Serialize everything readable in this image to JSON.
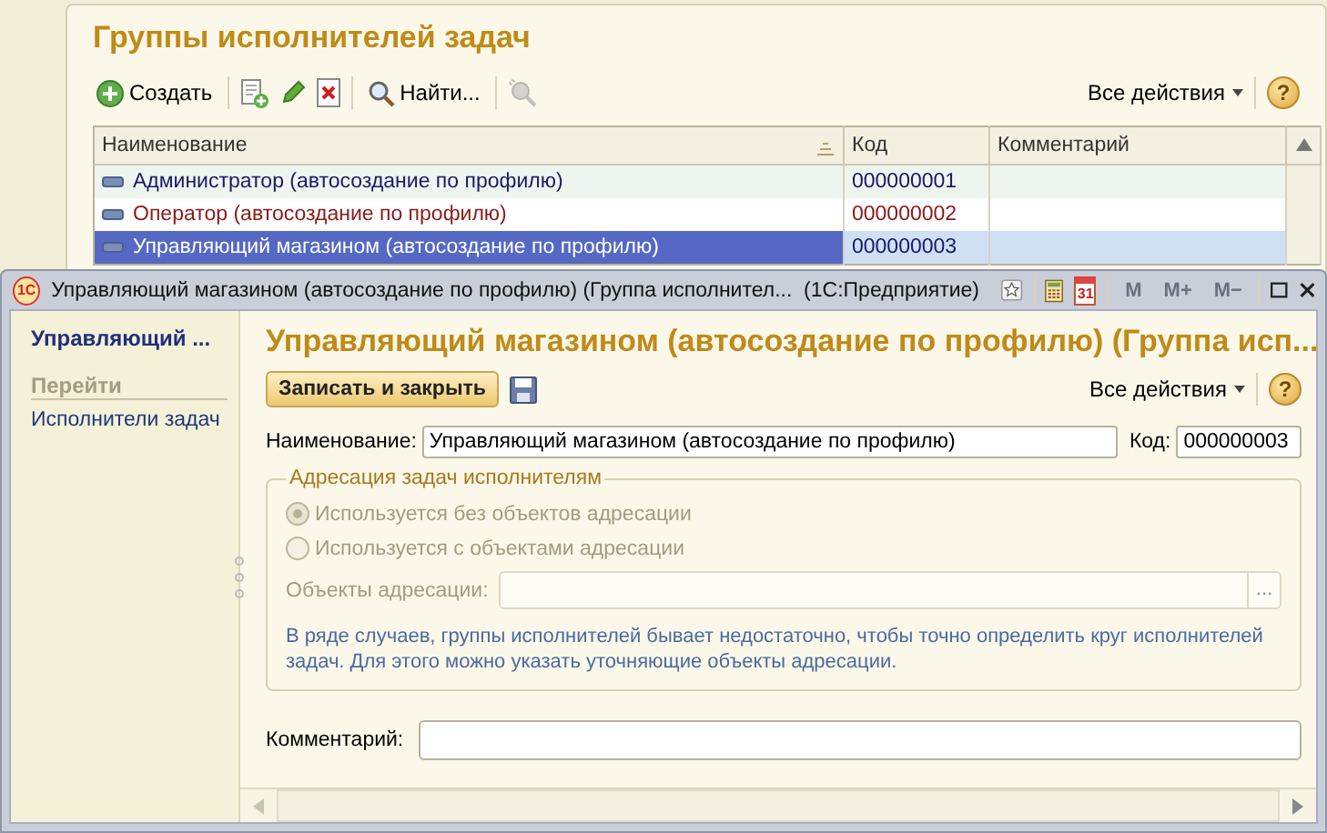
{
  "list_window": {
    "title": "Группы исполнителей задач",
    "toolbar": {
      "create": "Создать",
      "find": "Найти...",
      "all_actions": "Все действия",
      "help": "?"
    },
    "table": {
      "columns": [
        "Наименование",
        "Код",
        "Комментарий"
      ],
      "rows": [
        {
          "name": "Администратор (автосоздание по профилю)",
          "code": "000000001",
          "color": "#1a1a6a",
          "selected": false
        },
        {
          "name": "Оператор (автосоздание по профилю)",
          "code": "000000002",
          "color": "#8b1a1a",
          "selected": false
        },
        {
          "name": "Управляющий магазином (автосоздание по профилю)",
          "code": "000000003",
          "color": "#1a1a6a",
          "selected": true
        }
      ]
    }
  },
  "form_window": {
    "logo": "1С",
    "title": "Управляющий магазином (автосоздание по профилю) (Группа исполнител...  (1С:Предприятие)",
    "calendar_day": "31",
    "memory_buttons": [
      "M",
      "M+",
      "M−"
    ],
    "sidebar": {
      "title": "Управляющий ...",
      "section": "Перейти",
      "links": [
        "Исполнители задач"
      ]
    },
    "heading": "Управляющий магазином (автосоздание по профилю) (Группа исп...",
    "toolbar": {
      "save_close": "Записать и закрыть",
      "all_actions": "Все действия",
      "help": "?"
    },
    "name_label": "Наименование:",
    "name_value": "Управляющий магазином (автосоздание по профилю)",
    "code_label": "Код:",
    "code_value": "000000003",
    "group": {
      "title": "Адресация задач исполнителям",
      "options": [
        {
          "label": "Используется без объектов адресации",
          "selected": true,
          "disabled": true
        },
        {
          "label": "Используется с объектами адресации",
          "selected": false,
          "disabled": true
        }
      ],
      "objects_label": "Объекты адресации:",
      "objects_button": "...",
      "hint": "В ряде случаев, группы исполнителей бывает недостаточно, чтобы точно определить круг исполнителей задач. Для этого можно указать уточняющие объекты адресации."
    },
    "comment_label": "Комментарий:"
  }
}
